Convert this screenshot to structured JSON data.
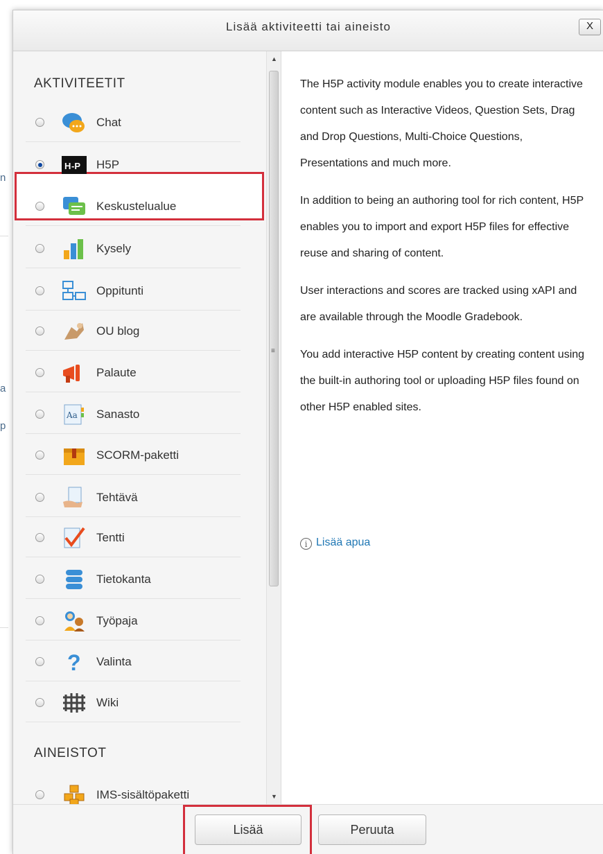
{
  "dialog": {
    "title": "Lisää aktiviteetti tai aineisto",
    "close_label": "X"
  },
  "left_panel": {
    "activities_heading": "AKTIVITEETIT",
    "resources_heading": "AINEISTOT",
    "activities": [
      {
        "label": "Chat",
        "icon": "chat-icon",
        "selected": false
      },
      {
        "label": "H5P",
        "icon": "h5p-icon",
        "selected": true
      },
      {
        "label": "Keskustelualue",
        "icon": "forum-icon",
        "selected": false
      },
      {
        "label": "Kysely",
        "icon": "survey-chart-icon",
        "selected": false
      },
      {
        "label": "Oppitunti",
        "icon": "lesson-icon",
        "selected": false
      },
      {
        "label": "OU blog",
        "icon": "blog-icon",
        "selected": false
      },
      {
        "label": "Palaute",
        "icon": "megaphone-icon",
        "selected": false
      },
      {
        "label": "Sanasto",
        "icon": "glossary-icon",
        "selected": false
      },
      {
        "label": "SCORM-paketti",
        "icon": "scorm-package-icon",
        "selected": false
      },
      {
        "label": "Tehtävä",
        "icon": "assignment-icon",
        "selected": false
      },
      {
        "label": "Tentti",
        "icon": "quiz-check-icon",
        "selected": false
      },
      {
        "label": "Tietokanta",
        "icon": "database-icon",
        "selected": false
      },
      {
        "label": "Työpaja",
        "icon": "workshop-icon",
        "selected": false
      },
      {
        "label": "Valinta",
        "icon": "question-mark-icon",
        "selected": false
      },
      {
        "label": "Wiki",
        "icon": "wiki-icon",
        "selected": false
      }
    ],
    "resources": [
      {
        "label": "IMS-sisältöpaketti",
        "icon": "ims-package-icon",
        "selected": false
      }
    ]
  },
  "description": {
    "paragraphs": [
      "The H5P activity module enables you to create interactive content such as Interactive Videos, Question Sets, Drag and Drop Questions, Multi-Choice Questions, Presentations and much more.",
      "In addition to being an authoring tool for rich content, H5P enables you to import and export H5P files for effective reuse and sharing of content.",
      "User interactions and scores are tracked using xAPI and are available through the Moodle Gradebook.",
      "You add interactive H5P content by creating content using the built-in authoring tool or uploading H5P files found on other H5P enabled sites."
    ],
    "help_link": "Lisää apua"
  },
  "footer": {
    "add_label": "Lisää",
    "cancel_label": "Peruuta"
  },
  "colors": {
    "highlight": "#d32f3c",
    "link": "#1f77b4",
    "selected_radio": "#0d47a1"
  }
}
